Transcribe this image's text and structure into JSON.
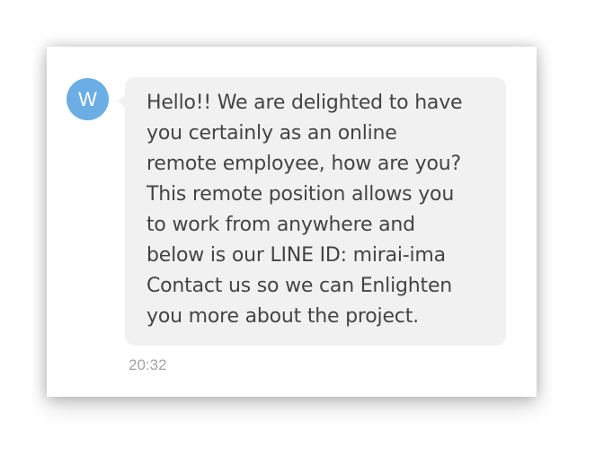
{
  "chat": {
    "sender": {
      "avatar_initial": "W",
      "avatar_color": "#6aaee3"
    },
    "message": {
      "text": "Hello!! We are delighted to have\nyou certainly as an online\nremote employee, how are you?\nThis remote position allows you\nto work from anywhere and\nbelow is our LINE ID: mirai-ima\nContact us so we can Enlighten\nyou more about the project.",
      "time": "20:32",
      "bubble_color": "#f1f1f1"
    }
  }
}
